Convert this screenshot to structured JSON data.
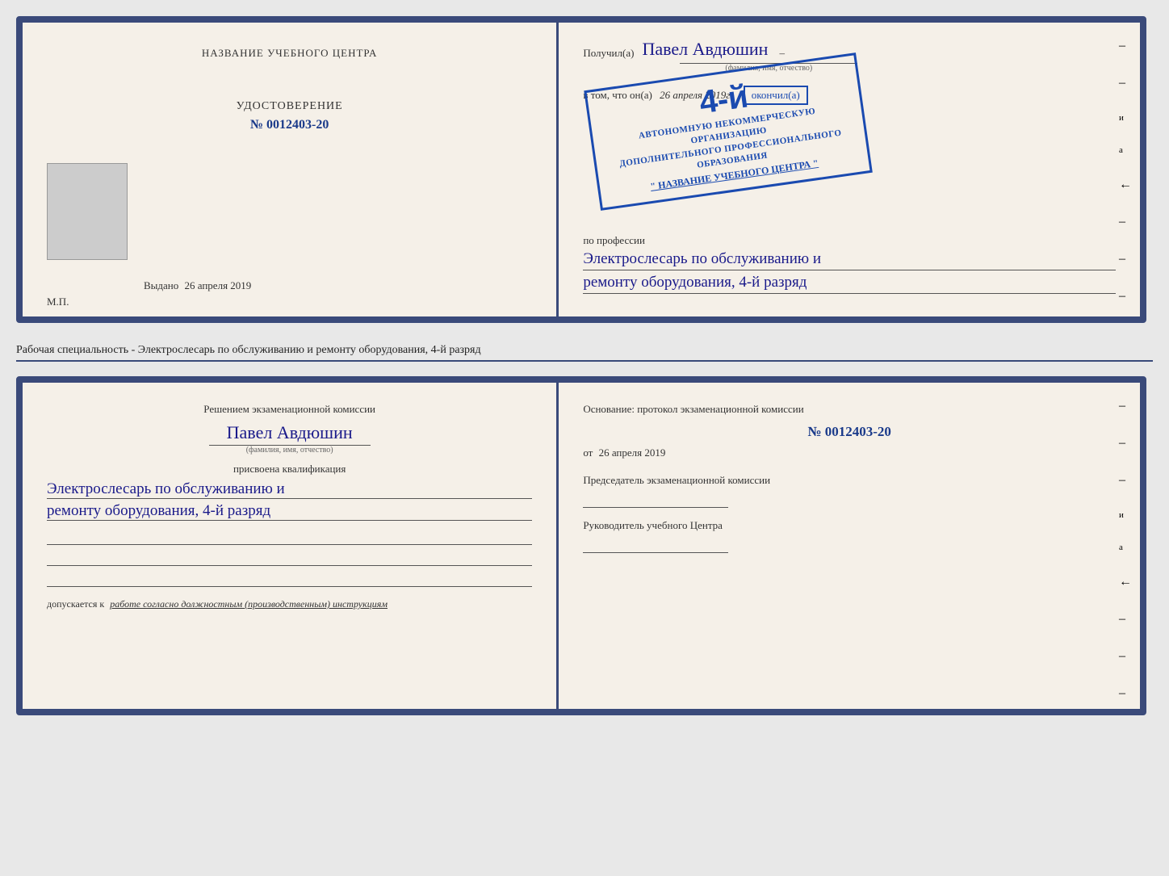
{
  "top_doc": {
    "left": {
      "center_title": "НАЗВАНИЕ УЧЕБНОГО ЦЕНТРА",
      "udostoverenie_label": "УДОСТОВЕРЕНИЕ",
      "number": "№ 0012403-20",
      "vydano_label": "Выдано",
      "vydano_date": "26 апреля 2019",
      "mp_label": "М.П."
    },
    "right": {
      "poluchil_label": "Получил(а)",
      "person_name": "Павел Авдюшин",
      "fio_subtitle": "(фамилия, имя, отчество)",
      "vtom_label": "в том, что он(а)",
      "vtom_date": "26 апреля 2019г.",
      "okonchil_label": "окончил(а)",
      "stamp_num": "4-й",
      "stamp_line1": "АВТОНОМНУЮ НЕКОММЕРЧЕСКУЮ ОРГАНИЗАЦИЮ",
      "stamp_line2": "ДОПОЛНИТЕЛЬНОГО ПРОФЕССИОНАЛЬНОГО ОБРАЗОВАНИЯ",
      "stamp_name": "\" НАЗВАНИЕ УЧЕБНОГО ЦЕНТРА \"",
      "po_professii": "по профессии",
      "profession_line1": "Электрослесарь по обслуживанию и",
      "profession_line2": "ремонту оборудования, 4-й разряд"
    }
  },
  "specialty_text": "Рабочая специальность - Электрослесарь по обслуживанию и ремонту оборудования, 4-й разряд",
  "bottom_doc": {
    "left": {
      "resheniem_title": "Решением экзаменационной комиссии",
      "person_name": "Павел Авдюшин",
      "fio_subtitle": "(фамилия, имя, отчество)",
      "prisvoena": "присвоена квалификация",
      "qual_line1": "Электрослесарь по обслуживанию и",
      "qual_line2": "ремонту оборудования, 4-й разряд",
      "dopuskaetsya_label": "допускается к",
      "dopuskaetsya_val": "работе согласно должностным (производственным) инструкциям"
    },
    "right": {
      "osnovanie_label": "Основание: протокол экзаменационной  комиссии",
      "protocol_num": "№  0012403-20",
      "ot_label": "от",
      "ot_date": "26 апреля 2019",
      "chairman_label": "Председатель экзаменационной комиссии",
      "rukovoditel_label": "Руководитель учебного Центра"
    }
  },
  "edge_letters": [
    "и",
    "а",
    "←",
    "–",
    "–",
    "–",
    "–"
  ]
}
